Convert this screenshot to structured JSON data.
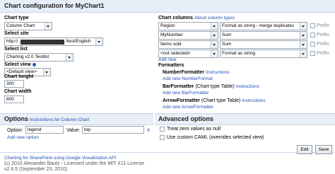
{
  "window": {
    "title": "Chart configuration for MyChart1"
  },
  "left": {
    "chart_type": {
      "label": "Chart type",
      "value": "Column Chart"
    },
    "site": {
      "label": "Select site",
      "prefix": "http://",
      "suffix": "/test/English"
    },
    "list": {
      "label": "Select list",
      "value": "Charting v2.0 Testlist"
    },
    "view": {
      "label": "Select view",
      "value": "<Default view>"
    },
    "height": {
      "label": "Chart height",
      "value": "300"
    },
    "width": {
      "label": "Chart width",
      "value": "800"
    }
  },
  "columns": {
    "label": "Chart columns",
    "about_link": "About column types",
    "rows": [
      {
        "column": "Region",
        "format": "Format as string - merge duplicates",
        "prefix": "Prefix"
      },
      {
        "column": "MyNumber",
        "format": "Sum",
        "prefix": "Prefix"
      },
      {
        "column": "Items sold",
        "format": "Sum",
        "prefix": "Prefix"
      },
      {
        "column": "<not selected>",
        "format": "Format as string",
        "prefix": "Prefix"
      }
    ],
    "add_new": "Add new"
  },
  "formatters": {
    "label": "Formatters",
    "items": [
      {
        "name": "NumberFormatter",
        "suffix": "",
        "instructions": "Instructions",
        "add": "Add new NumberFormat"
      },
      {
        "name": "BarFormatter",
        "suffix": "(Chart type Table)",
        "instructions": "Instructions",
        "add": "Add new BarFormatter"
      },
      {
        "name": "ArrowFormatter",
        "suffix": "(Chart type Table)",
        "instructions": "Instructions",
        "add": "Add new ArrowFormatter"
      }
    ]
  },
  "options": {
    "title": "Options",
    "instructions": "Instructions for Column Chart",
    "option_label": "Option:",
    "option_value": "legend",
    "value_label": "Value:",
    "value_value": "top",
    "remove": "x",
    "add_new": "Add new option"
  },
  "advanced": {
    "title": "Advanced options",
    "treat_zero": "Treat zero values as null",
    "custom_caml": "Use custom CAML (overrides selected view)"
  },
  "footer": {
    "line1_link": "Charting for SharePoint using Google Visualization API",
    "line2": "(c) 2010 Alexander Bautz - Licensed under the MIT X11 License",
    "line3": "v2.6.5 (September 23, 2010)"
  },
  "buttons": {
    "edit": "Edit",
    "save": "Save"
  }
}
